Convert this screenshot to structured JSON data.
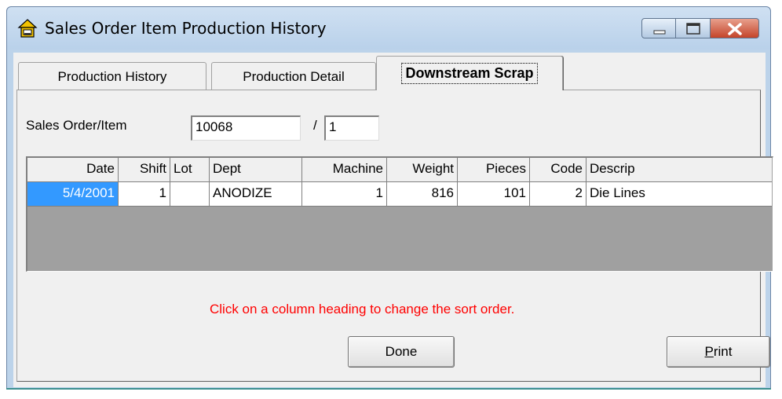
{
  "window": {
    "title": "Sales Order Item Production History",
    "icon": "house-print-icon"
  },
  "tabs": [
    {
      "label": "Production History",
      "active": false
    },
    {
      "label": "Production Detail",
      "active": false
    },
    {
      "label": "Downstream Scrap",
      "active": true
    }
  ],
  "order": {
    "label": "Sales Order/Item",
    "sales_order": "10068",
    "separator": "/",
    "item": "1"
  },
  "grid": {
    "columns": [
      "Date",
      "Shift",
      "Lot",
      "Dept",
      "Machine",
      "Weight",
      "Pieces",
      "Code",
      "Descrip"
    ],
    "rows": [
      {
        "date": "5/4/2001",
        "shift": "1",
        "lot": "",
        "dept": "ANODIZE",
        "machine": "1",
        "weight": "816",
        "pieces": "101",
        "code": "2",
        "descrip": "Die Lines"
      }
    ]
  },
  "hint": "Click on a column heading to change the sort order.",
  "buttons": {
    "done": "Done",
    "print_mnemonic": "P",
    "print_rest": "rint"
  },
  "colors": {
    "selection": "#3399ff",
    "hint": "#ff0000"
  }
}
